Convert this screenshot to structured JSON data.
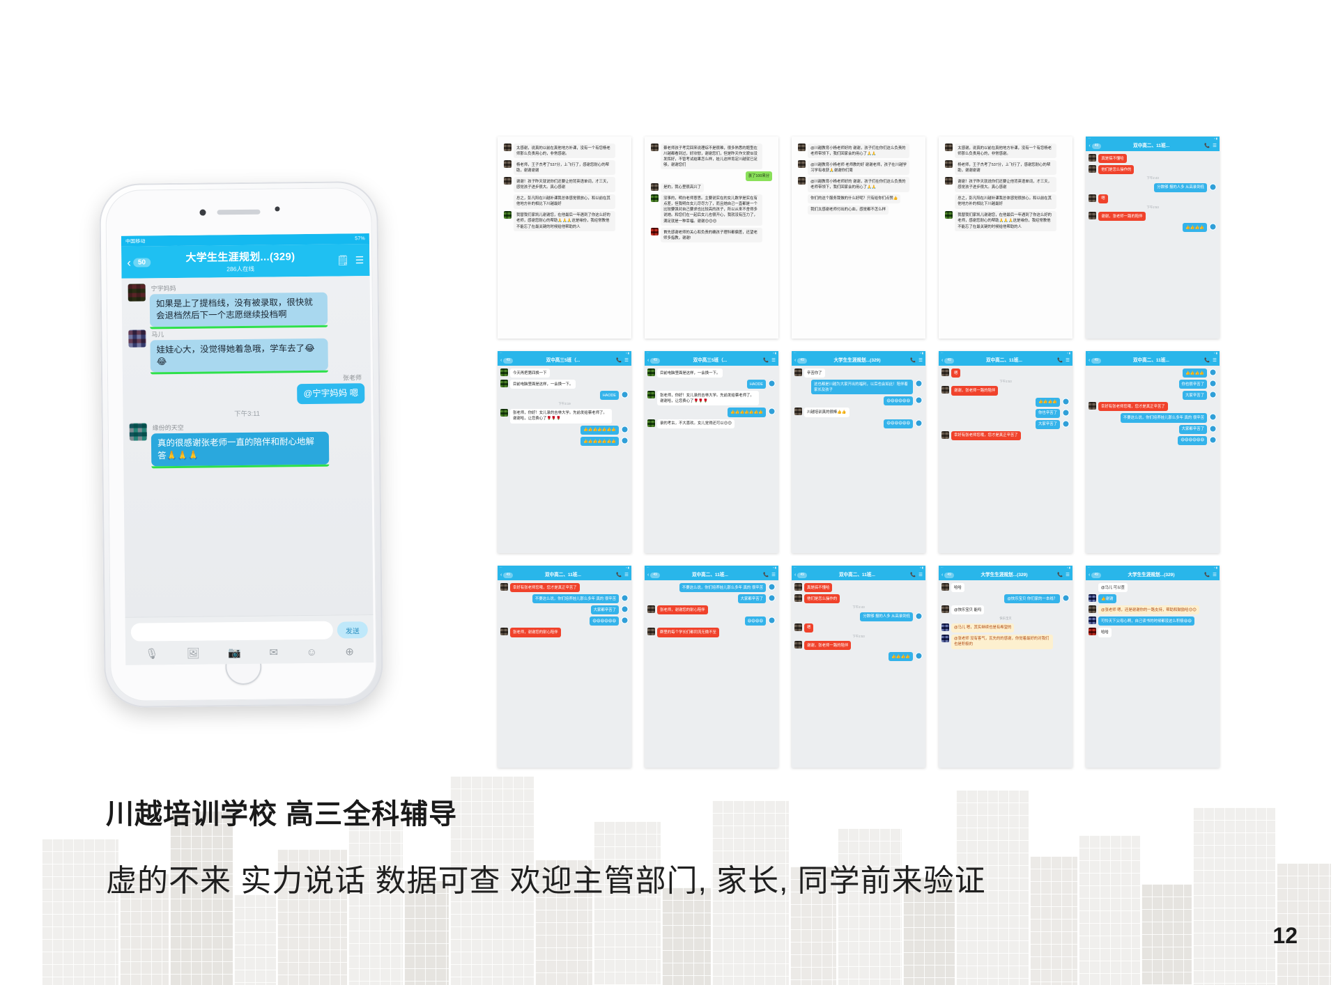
{
  "slide": {
    "title": "川越培训学校 高三全科辅导",
    "subtitle": "虚的不来 实力说话 数据可查 欢迎主管部门, 家长, 同学前来验证",
    "page_number": "12"
  },
  "phone": {
    "statusbar": {
      "carrier": "中国移动",
      "signal": "ıll ıll",
      "battery": "57%",
      "time": "下午3:11"
    },
    "header": {
      "back_badge": "50",
      "title": "大学生生涯规划...(329)",
      "online": "286人在线",
      "note_icon": "note-icon",
      "menu_icon": "menu-icon"
    },
    "messages": [
      {
        "side": "them",
        "nick": "宁宇妈妈",
        "text": "如果是上了提档线，没有被录取，很快就会退档然后下一个志愿继续投档啊",
        "avatar": "a1",
        "style": "them"
      },
      {
        "side": "them",
        "nick": "马儿",
        "text": "娃娃心大，没觉得她着急哦，学车去了😂😂",
        "avatar": "a2",
        "style": "them"
      },
      {
        "side": "me",
        "nick": "张老师",
        "text": "@宁宇妈妈 嗯",
        "style": "me"
      },
      {
        "side": "time",
        "text": "下午3:11"
      },
      {
        "side": "them",
        "nick": "缘份的天空",
        "text": "真的很感谢张老师一直的陪伴和耐心地解答🙏🙏🙏",
        "avatar": "a3",
        "style": "them2"
      }
    ],
    "input": {
      "placeholder": "",
      "send_label": "发送"
    },
    "tools": [
      "mic-icon",
      "image-icon",
      "camera-icon",
      "envelope-icon",
      "smiley-icon",
      "plus-icon"
    ]
  },
  "screenshots": [
    {
      "id": "s1",
      "kind": "white",
      "title": "",
      "messages": [
        {
          "av": "gray",
          "bg": "gy",
          "text": "太感谢，说真的以前在真他地方补课，没有一个有您杨老师那么负责用心的，非常感谢。"
        },
        {
          "av": "photo",
          "bg": "gy",
          "text": "杨老师，王子杰考了537分，上飞行了，感谢您耐心的帮助，谢谢谢谢"
        },
        {
          "av": "gray",
          "bg": "gy",
          "text": "谢谢！孩子昨天就说你们还要让他背英语单词，才三天，感觉孩子进步很大。真心感谢"
        },
        {
          "av": "none",
          "bg": "gy",
          "text": "总之，彭凡阳在川越补课我总体感觉很放心，和以前在其他地方补的相比下川越最好"
        },
        {
          "av": "green",
          "bg": "gy",
          "text": "我替我们家凯儿谢谢您，在他最后一年遇到了你这么好的老师，感谢您耐心的帮助🙏🙏🙏这是缘份，我经常教他不能忘了在最关键的时候给他帮助的人"
        }
      ]
    },
    {
      "id": "s2",
      "kind": "white",
      "title": "",
      "messages": [
        {
          "av": "photo",
          "bg": "gy",
          "text": "蔡老师孩子考完回来说理综不是很难，很多熟悉的题型在川越都看到过，好欣慰，谢谢您们，但是昨天作文貌似没发挥好，不管考试结果怎么样，娃儿这样肯定川越就已足够，谢谢您们"
        },
        {
          "av": "none",
          "bg": "gr",
          "right": true,
          "text": "涨了100来分"
        },
        {
          "av": "photo",
          "bg": "gy",
          "text": "是的，我心里很高兴了"
        },
        {
          "av": "green",
          "bg": "gy",
          "text": "没事的，明白老师意思。主要说实在的女儿数学是实在有点差，但我明白女儿尽尽力了，而且她自己一直都是一个比较要强对自己要求也比较高的孩子，所以从来不舍得多说她。和您们在一起后女儿也很开心，我就没有压力了，满足就是一种幸福。谢谢😊😊😊"
        },
        {
          "av": "red",
          "bg": "gy",
          "text": "首先感谢老师的关心和负责的确孩子理科都偏差，还望老师多指教，谢谢!"
        }
      ]
    },
    {
      "id": "s3",
      "kind": "white",
      "title": "",
      "messages": [
        {
          "av": "gray",
          "bg": "gy",
          "text": "@川越教育小杨老师好的 谢谢，孩子们在你们这么负责的老师带领下，我们回家会的用心了🙏🙏"
        },
        {
          "av": "gray",
          "bg": "gy",
          "text": "@川越教育小杨老师 老师教的好 谢谢老师，孩子在川越学习学有收获🙏谢谢你们周"
        },
        {
          "av": "gray",
          "bg": "gy",
          "text": "@川越教育小杨老师好的 谢谢，孩子们在你们这么负责的老师带领下，我们回家会的用心了🙏🙏"
        },
        {
          "av": "none",
          "bg": "gy",
          "text": "你们的这个服务我做的什么好呢？只有给你们点赞👍"
        },
        {
          "av": "none",
          "bg": "gy",
          "text": "我们太感谢老师付出的心血，感觉都不怎么样"
        }
      ]
    },
    {
      "id": "s4",
      "kind": "white",
      "title": "",
      "messages": [
        {
          "av": "gray",
          "bg": "gy",
          "text": "太感谢，说真的以前在真他地方补课，没有一个有您杨老师那么负责用心的，非常感谢。"
        },
        {
          "av": "photo",
          "bg": "gy",
          "text": "杨老师，王子杰考了537分，上飞行了，感谢您耐心的帮助，谢谢谢谢"
        },
        {
          "av": "gray",
          "bg": "gy",
          "text": "谢谢！孩子昨天就说你们还要让他背英语单词，才三天，感觉孩子进步很大。真心感谢"
        },
        {
          "av": "none",
          "bg": "gy",
          "text": "总之，彭凡阳在川越补课我总体感觉很放心，和以前在其他地方补的相比下川越最好"
        },
        {
          "av": "green",
          "bg": "gy",
          "text": "我替我们家凯儿谢谢您，在他最后一年遇到了你这么好的老师，感谢您耐心的帮助🙏🙏🙏这是缘份，我经常教他不能忘了在最关键的时候给他帮助的人"
        }
      ]
    },
    {
      "id": "s5",
      "kind": "chat",
      "title": "双中高二、11班...",
      "online": "",
      "messages": [
        {
          "av": "gray",
          "bg": "rd",
          "text": "真是搞不懂哈"
        },
        {
          "av": "gray",
          "bg": "rd",
          "text": "他们是怎么操作的"
        },
        {
          "time": "下午2:43"
        },
        {
          "right": true,
          "bg": "bl",
          "text": "分数够 报的人多 从高录到低",
          "logo": true
        },
        {
          "av": "gray",
          "bg": "rd",
          "text": "嗯"
        },
        {
          "time": "下午2:53"
        },
        {
          "av": "gray",
          "bg": "rd",
          "text": "谢谢，张老师一路的陪伴"
        },
        {
          "right": true,
          "bg": "bl",
          "text": "👍👍👍👍",
          "logo": true
        }
      ]
    },
    {
      "id": "s6",
      "kind": "chat",
      "title": "双中高三5班（...",
      "online": "iPhone 7 Plus王伟",
      "messages": [
        {
          "av": "green",
          "bg": "w",
          "text": "今天再把第四换一下"
        },
        {
          "av": "green",
          "bg": "w",
          "text": "目前电脑里面是这样，一会换一下。"
        },
        {
          "right": true,
          "bg": "bl",
          "text": "HAODE",
          "logo": true
        },
        {
          "time": "下午3:19"
        },
        {
          "av": "green",
          "bg": "w",
          "text": "张老师，你好！女儿录的吉林大学。先前发给蔡老师了。谢谢哈，让您费心了🌹🌹🌹"
        },
        {
          "right": true,
          "bg": "bl",
          "text": "👍👍👍👍👍👍👍",
          "logo": true
        },
        {
          "right": true,
          "bg": "bl",
          "text": "👍👍👍👍👍👍👍",
          "logo": true
        }
      ]
    },
    {
      "id": "s7",
      "kind": "chat",
      "title": "双中高三5班（...",
      "online": "",
      "messages": [
        {
          "av": "green",
          "bg": "w",
          "text": "目前电脑里面是这样，一会换一下。"
        },
        {
          "right": true,
          "bg": "bl",
          "text": "HAODE",
          "logo": true
        },
        {
          "av": "green",
          "bg": "w",
          "text": "张老师，你好！女儿录的吉林大学。先前发给蔡老师了。谢谢哈，让您费心了🌹🌹🌹"
        },
        {
          "right": true,
          "bg": "bl",
          "text": "👍👍👍👍👍👍👍",
          "logo": true
        },
        {
          "av": "green",
          "bg": "w",
          "text": "录的考古，不大喜欢。女儿觉得还可以😊😊"
        }
      ]
    },
    {
      "id": "s8",
      "kind": "chat",
      "title": "大学生生涯规划...(329)",
      "online": "286人在线",
      "messages": [
        {
          "av": "gray",
          "bg": "w",
          "text": "辛苦你了"
        },
        {
          "right": true,
          "bg": "bl",
          "text": "这也都是川越为大家开出的福利，以后也会如此！陪伴着家长及孩子",
          "logo": true
        },
        {
          "right": true,
          "bg": "bl",
          "text": "😄😄😄😄😄😄",
          "logo": true
        },
        {
          "av": "gray",
          "bg": "w",
          "text": "川越培训真的很棒👍👍"
        },
        {
          "right": true,
          "bg": "bl",
          "text": "😄😄😄😄😄😄",
          "logo": true
        }
      ]
    },
    {
      "id": "s9",
      "kind": "chat",
      "title": "双中高二、11班...",
      "online": "",
      "messages": [
        {
          "av": "gray",
          "bg": "rd",
          "text": "嗯"
        },
        {
          "time": "下午2:53"
        },
        {
          "av": "gray",
          "bg": "rd",
          "text": "谢谢，张老师一路的陪伴"
        },
        {
          "right": true,
          "bg": "bl",
          "text": "👍👍👍👍",
          "logo": true
        },
        {
          "right": true,
          "bg": "bl",
          "text": "你也辛苦了",
          "logo": true
        },
        {
          "right": true,
          "bg": "bl",
          "text": "大家辛苦了",
          "logo": true
        },
        {
          "av": "gray",
          "bg": "rd",
          "text": "幸好有张老师您哦，您才是真正辛苦了"
        }
      ]
    },
    {
      "id": "s10",
      "kind": "chat",
      "title": "双中高二、11班...",
      "online": "",
      "messages": [
        {
          "right": true,
          "bg": "bl",
          "text": "👍👍👍👍",
          "logo": true
        },
        {
          "right": true,
          "bg": "bl",
          "text": "你也很辛苦了",
          "logo": true
        },
        {
          "right": true,
          "bg": "bl",
          "text": "大家辛苦了",
          "logo": true
        },
        {
          "av": "gray",
          "bg": "rd",
          "text": "幸好有张老师您哦，您才是真正辛苦了"
        },
        {
          "right": true,
          "bg": "bl",
          "text": "不要这么说，你们培养娃儿那么多年 真的 很辛苦",
          "logo": true
        },
        {
          "right": true,
          "bg": "bl",
          "text": "大家都辛苦了",
          "logo": true
        },
        {
          "right": true,
          "bg": "bl",
          "text": "😄😄😄😄😄😄",
          "logo": true
        }
      ]
    },
    {
      "id": "s11",
      "kind": "chat",
      "title": "双中高二、11班...",
      "online": "",
      "messages": [
        {
          "av": "gray",
          "bg": "rd",
          "text": "幸好有张老师您哦，您才是真正辛苦了"
        },
        {
          "right": true,
          "bg": "bl",
          "text": "不要这么说，你们培养娃儿那么多年 真的 很辛苦",
          "logo": true
        },
        {
          "right": true,
          "bg": "bl",
          "text": "大家都辛苦了",
          "logo": true
        },
        {
          "right": true,
          "bg": "bl",
          "text": "😄😄😄😄😄😄",
          "logo": true
        },
        {
          "av": "gray",
          "bg": "rd",
          "text": "张老师，谢谢您的耐心陪伴"
        }
      ]
    },
    {
      "id": "s12",
      "kind": "chat",
      "title": "双中高二、11班...",
      "online": "",
      "messages": [
        {
          "right": true,
          "bg": "bl",
          "text": "不要这么说，你们培养娃儿那么多年 真的 很辛苦",
          "logo": true
        },
        {
          "right": true,
          "bg": "bl",
          "text": "大家都辛苦了",
          "logo": true
        },
        {
          "av": "gray",
          "bg": "rd",
          "text": "张老师，谢谢您的耐心陪伴"
        },
        {
          "right": true,
          "bg": "bl",
          "text": "😄😄😄😄",
          "logo": true
        },
        {
          "av": "gray",
          "bg": "rd",
          "text": "群里的每个学长们都同流无微不至"
        }
      ]
    },
    {
      "id": "s13",
      "kind": "chat",
      "title": "双中高二、11班...",
      "online": "",
      "messages": [
        {
          "av": "gray",
          "bg": "rd",
          "text": "真是搞不懂哈"
        },
        {
          "av": "gray",
          "bg": "rd",
          "text": "他们是怎么操作的"
        },
        {
          "time": "下午2:43"
        },
        {
          "right": true,
          "bg": "bl",
          "text": "分数够 报的人多 从高录到低",
          "logo": true
        },
        {
          "av": "gray",
          "bg": "rd",
          "text": "嗯"
        },
        {
          "time": "下午2:53"
        },
        {
          "av": "gray",
          "bg": "rd",
          "text": "谢谢，张老师一路的陪伴"
        },
        {
          "right": true,
          "bg": "bl",
          "text": "👍👍👍👍",
          "logo": true
        }
      ]
    },
    {
      "id": "s14",
      "kind": "chat",
      "title": "大学生生涯规划...(329)",
      "online": "286人在线",
      "messages": [
        {
          "av": "gray",
          "bg": "w",
          "text": "哈哈"
        },
        {
          "right": true,
          "bg": "bl",
          "text": "@快乐宝贝 你们家的一本线？",
          "logo": true
        },
        {
          "av": "gray",
          "bg": "w",
          "text": "@快乐宝贝 能吗"
        },
        {
          "time": "快乐宝贝"
        },
        {
          "av": "blue",
          "bg": "yl",
          "text": "@马儿 嗯，其实继续也是有希望的"
        },
        {
          "av": "blue",
          "bg": "yl",
          "text": "@张老师 没有客气，瓦先的的感谢，你觉着最好的对我们也是积极的"
        }
      ]
    },
    {
      "id": "s15",
      "kind": "chat",
      "title": "大学生生涯规划...(329)",
      "online": "286人在线",
      "messages": [
        {
          "av": "none",
          "bg": "w",
          "text": "@马儿 可以查"
        },
        {
          "av": "blue",
          "bg": "bl",
          "text": "👍谢谢",
          "nick": "马儿"
        },
        {
          "av": "gray",
          "bg": "yl",
          "text": "@张老师 嗯，还是谢谢你的一路支持，帮助和鼓励哈😊😊",
          "nick": "快乐宝贝"
        },
        {
          "av": "blue",
          "bg": "bl",
          "text": "可怜天下父母心啊，自己读书的时候都没这么积极😄😄",
          "nick": "马儿"
        },
        {
          "av": "red",
          "bg": "w",
          "text": "哈哈",
          "nick": "双中高3"
        }
      ]
    }
  ]
}
